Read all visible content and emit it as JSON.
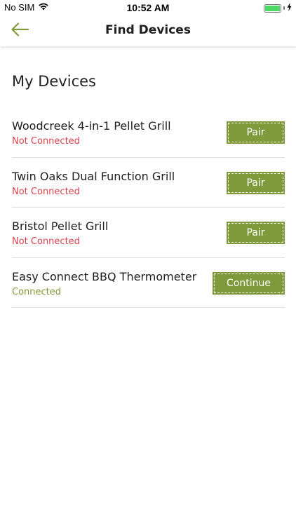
{
  "status_bar": {
    "carrier": "No SIM",
    "time": "10:52 AM",
    "battery_level": 1.0,
    "battery_color": "#4cd964"
  },
  "header": {
    "title": "Find Devices",
    "back_icon": "arrow-left-icon",
    "accent": "#7f9a3a"
  },
  "section": {
    "title": "My Devices"
  },
  "devices": [
    {
      "name": "Woodcreek 4-in-1 Pellet Grill",
      "status": "Not Connected",
      "action": "Pair"
    },
    {
      "name": "Twin Oaks Dual Function Grill",
      "status": "Not Connected",
      "action": "Pair"
    },
    {
      "name": "Bristol Pellet Grill",
      "status": "Not Connected",
      "action": "Pair"
    },
    {
      "name": "Easy Connect BBQ Thermometer",
      "status": "Connected",
      "action": "Continue"
    }
  ],
  "colors": {
    "not_connected": "#d9434e",
    "connected": "#7f9a3a",
    "button": "#7f9a3a"
  }
}
